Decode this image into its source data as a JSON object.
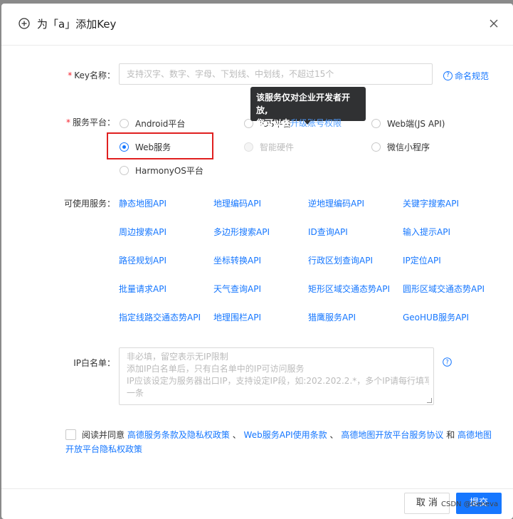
{
  "dialog": {
    "title": "为「a」添加Key",
    "close_icon": "close-icon",
    "title_icon": "add-circle-icon"
  },
  "key_name": {
    "label": "Key名称：",
    "required": "*",
    "placeholder": "支持汉字、数字、字母、下划线、中划线，不超过15个",
    "help": "命名规范"
  },
  "platform": {
    "label": "服务平台：",
    "required": "*",
    "options": [
      {
        "label": "Android平台",
        "state": "unchecked"
      },
      {
        "label": "iOS平台",
        "state": "unchecked"
      },
      {
        "label": "Web端(JS API)",
        "state": "unchecked"
      },
      {
        "label": "Web服务",
        "state": "checked"
      },
      {
        "label": "智能硬件",
        "state": "disabled"
      },
      {
        "label": "微信小程序",
        "state": "unchecked"
      },
      {
        "label": "HarmonyOS平台",
        "state": "unchecked"
      }
    ],
    "tooltip": {
      "line1": "该服务仅对企业开发者开放,",
      "line2_prefix": "您可以去",
      "line2_link": "升级账号权限"
    }
  },
  "services": {
    "label": "可使用服务：",
    "items": [
      "静态地图API",
      "地理编码API",
      "逆地理编码API",
      "关键字搜索API",
      "周边搜索API",
      "多边形搜索API",
      "ID查询API",
      "输入提示API",
      "路径规划API",
      "坐标转换API",
      "行政区划查询API",
      "IP定位API",
      "批量请求API",
      "天气查询API",
      "矩形区域交通态势API",
      "圆形区域交通态势API",
      "指定线路交通态势API",
      "地理围栏API",
      "猎鹰服务API",
      "GeoHUB服务API"
    ]
  },
  "ip_whitelist": {
    "label": "IP白名单：",
    "placeholder_lines": [
      "非必填，留空表示无IP限制",
      "添加IP白名单后，只有白名单中的IP可访问服务",
      "IP应该设定为服务器出口IP，支持设定IP段，如:202.202.2.*，多个IP请每行填写一",
      "一条"
    ]
  },
  "agreement": {
    "prefix": "阅读并同意",
    "link1": "高德服务条款及隐私权政策",
    "sep1": "、",
    "link2": "Web服务API使用条款",
    "sep2": "、",
    "link3": "高德地图开放平台服务协议",
    "and": "和",
    "link4": "高德地图开放平台隐私权政策"
  },
  "footer": {
    "cancel": "取 消",
    "submit": "提交"
  },
  "watermark": "CSDN @Geneva",
  "colors": {
    "accent": "#1677ff",
    "required": "#f5222d",
    "highlight": "#e02020"
  }
}
